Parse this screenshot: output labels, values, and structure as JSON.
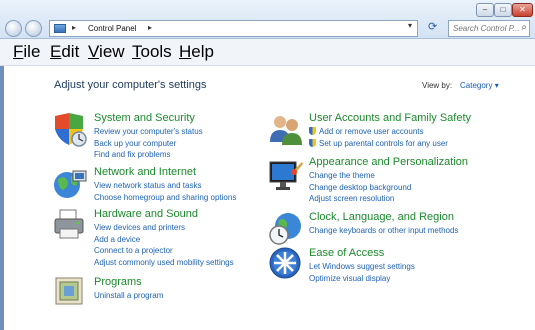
{
  "address_bar": {
    "crumb": "Control Panel"
  },
  "search": {
    "placeholder": "Search Control P..."
  },
  "menu": [
    "File",
    "Edit",
    "View",
    "Tools",
    "Help"
  ],
  "heading": "Adjust your computer's settings",
  "view_by": {
    "label": "View by:",
    "value": "Category"
  },
  "categories": {
    "system": {
      "title": "System and Security",
      "links": [
        "Review your computer's status",
        "Back up your computer",
        "Find and fix problems"
      ]
    },
    "network": {
      "title": "Network and Internet",
      "links": [
        "View network status and tasks",
        "Choose homegroup and sharing options"
      ]
    },
    "hardware": {
      "title": "Hardware and Sound",
      "links": [
        "View devices and printers",
        "Add a device",
        "Connect to a projector",
        "Adjust commonly used mobility settings"
      ]
    },
    "programs": {
      "title": "Programs",
      "links": [
        "Uninstall a program"
      ]
    },
    "users": {
      "title": "User Accounts and Family Safety",
      "links": [
        "Add or remove user accounts",
        "Set up parental controls for any user"
      ]
    },
    "appearance": {
      "title": "Appearance and Personalization",
      "links": [
        "Change the theme",
        "Change desktop background",
        "Adjust screen resolution"
      ]
    },
    "clock": {
      "title": "Clock, Language, and Region",
      "links": [
        "Change keyboards or other input methods"
      ]
    },
    "ease": {
      "title": "Ease of Access",
      "links": [
        "Let Windows suggest settings",
        "Optimize visual display"
      ]
    }
  },
  "colors": {
    "category_title": "#1c8a2d",
    "link": "#1e63b5",
    "heading": "#1e395b"
  }
}
